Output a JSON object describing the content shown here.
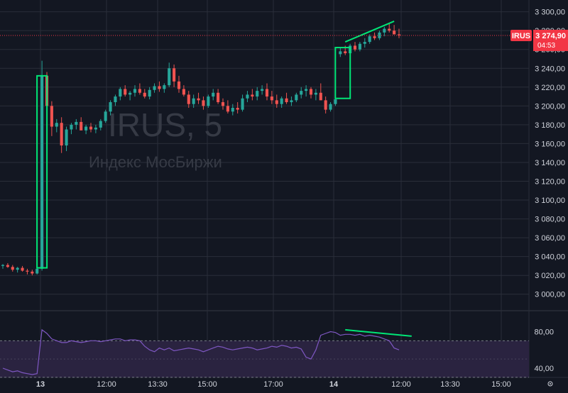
{
  "chart_data": {
    "type": "candlestick",
    "symbol": "IRUS, 5",
    "subtitle": "Индекс МосБиржи",
    "price_axis": {
      "ticks": [
        "3 300,00",
        "3 280,00",
        "3 260,00",
        "3 240,00",
        "3 220,00",
        "3 200,00",
        "3 180,00",
        "3 160,00",
        "3 140,00",
        "3 120,00",
        "3 100,00",
        "3 080,00",
        "3 060,00",
        "3 040,00",
        "3 020,00",
        "3 000,00"
      ],
      "ylim": [
        2990,
        3305
      ]
    },
    "time_axis": {
      "ticks": [
        {
          "label": "13",
          "bold": true
        },
        {
          "label": "12:00",
          "bold": false
        },
        {
          "label": "13:30",
          "bold": false
        },
        {
          "label": "15:00",
          "bold": false
        },
        {
          "label": "17:00",
          "bold": false
        },
        {
          "label": "14",
          "bold": true
        },
        {
          "label": "12:00",
          "bold": false
        },
        {
          "label": "13:30",
          "bold": false
        },
        {
          "label": "15:00",
          "bold": false
        }
      ]
    },
    "last_price": {
      "symbol_label": "IRUS",
      "price": "3 274,90",
      "countdown": "04:53",
      "value": 3274.9
    },
    "rsi": {
      "ticks": [
        "80,00",
        "40,00"
      ],
      "ylim": [
        33,
        92
      ],
      "band": [
        30,
        70
      ]
    },
    "candles": [
      [
        3030,
        3032,
        3027,
        3031
      ],
      [
        3031,
        3033,
        3028,
        3029
      ],
      [
        3029,
        3031,
        3024,
        3026
      ],
      [
        3026,
        3029,
        3023,
        3028
      ],
      [
        3028,
        3030,
        3024,
        3025
      ],
      [
        3025,
        3027,
        3021,
        3024
      ],
      [
        3024,
        3026,
        3020,
        3022
      ],
      [
        3022,
        3028,
        3021,
        3027
      ],
      [
        3027,
        3248,
        3025,
        3232
      ],
      [
        3232,
        3236,
        3195,
        3200
      ],
      [
        3200,
        3205,
        3168,
        3178
      ],
      [
        3178,
        3186,
        3172,
        3182
      ],
      [
        3182,
        3188,
        3150,
        3158
      ],
      [
        3158,
        3178,
        3152,
        3175
      ],
      [
        3175,
        3182,
        3170,
        3180
      ],
      [
        3180,
        3186,
        3175,
        3183
      ],
      [
        3183,
        3188,
        3178,
        3174
      ],
      [
        3174,
        3180,
        3170,
        3178
      ],
      [
        3178,
        3182,
        3172,
        3175
      ],
      [
        3175,
        3180,
        3171,
        3177
      ],
      [
        3177,
        3186,
        3174,
        3184
      ],
      [
        3184,
        3196,
        3182,
        3194
      ],
      [
        3194,
        3206,
        3190,
        3204
      ],
      [
        3204,
        3212,
        3200,
        3210
      ],
      [
        3210,
        3220,
        3206,
        3218
      ],
      [
        3218,
        3222,
        3210,
        3212
      ],
      [
        3212,
        3216,
        3206,
        3214
      ],
      [
        3214,
        3222,
        3210,
        3218
      ],
      [
        3218,
        3224,
        3212,
        3214
      ],
      [
        3214,
        3218,
        3208,
        3210
      ],
      [
        3210,
        3220,
        3207,
        3217
      ],
      [
        3217,
        3224,
        3214,
        3221
      ],
      [
        3221,
        3226,
        3215,
        3218
      ],
      [
        3218,
        3224,
        3214,
        3222
      ],
      [
        3222,
        3246,
        3220,
        3240
      ],
      [
        3240,
        3244,
        3220,
        3226
      ],
      [
        3226,
        3232,
        3214,
        3218
      ],
      [
        3218,
        3222,
        3210,
        3212
      ],
      [
        3212,
        3216,
        3198,
        3202
      ],
      [
        3202,
        3212,
        3198,
        3208
      ],
      [
        3208,
        3214,
        3202,
        3206
      ],
      [
        3206,
        3210,
        3196,
        3200
      ],
      [
        3200,
        3212,
        3198,
        3210
      ],
      [
        3210,
        3218,
        3206,
        3214
      ],
      [
        3214,
        3218,
        3202,
        3204
      ],
      [
        3204,
        3208,
        3196,
        3200
      ],
      [
        3200,
        3206,
        3192,
        3194
      ],
      [
        3194,
        3202,
        3190,
        3198
      ],
      [
        3198,
        3204,
        3192,
        3196
      ],
      [
        3196,
        3212,
        3194,
        3208
      ],
      [
        3208,
        3216,
        3204,
        3212
      ],
      [
        3212,
        3218,
        3206,
        3210
      ],
      [
        3210,
        3220,
        3206,
        3216
      ],
      [
        3216,
        3222,
        3212,
        3218
      ],
      [
        3218,
        3224,
        3206,
        3210
      ],
      [
        3210,
        3216,
        3202,
        3206
      ],
      [
        3206,
        3212,
        3198,
        3202
      ],
      [
        3202,
        3210,
        3198,
        3208
      ],
      [
        3208,
        3214,
        3202,
        3204
      ],
      [
        3204,
        3210,
        3200,
        3206
      ],
      [
        3206,
        3214,
        3204,
        3212
      ],
      [
        3212,
        3220,
        3208,
        3216
      ],
      [
        3216,
        3222,
        3210,
        3218
      ],
      [
        3218,
        3220,
        3208,
        3212
      ],
      [
        3212,
        3218,
        3206,
        3214
      ],
      [
        3214,
        3224,
        3210,
        3206
      ],
      [
        3206,
        3210,
        3192,
        3196
      ],
      [
        3196,
        3204,
        3194,
        3202
      ],
      [
        3202,
        3212,
        3200,
        3207
      ],
      [
        3255,
        3262,
        3252,
        3258
      ],
      [
        3258,
        3264,
        3254,
        3256
      ],
      [
        3256,
        3266,
        3254,
        3264
      ],
      [
        3264,
        3268,
        3258,
        3260
      ],
      [
        3260,
        3268,
        3258,
        3266
      ],
      [
        3266,
        3272,
        3262,
        3268
      ],
      [
        3268,
        3276,
        3266,
        3274
      ],
      [
        3274,
        3278,
        3270,
        3272
      ],
      [
        3272,
        3280,
        3270,
        3278
      ],
      [
        3278,
        3284,
        3274,
        3282
      ],
      [
        3282,
        3288,
        3278,
        3280
      ],
      [
        3280,
        3286,
        3276,
        3276
      ],
      [
        3276,
        3282,
        3272,
        3275
      ]
    ],
    "rsi_values": [
      40,
      38,
      36,
      37,
      35,
      34,
      33,
      34,
      82,
      78,
      72,
      70,
      68,
      68,
      70,
      69,
      68,
      69,
      70,
      70,
      69,
      70,
      71,
      72,
      72,
      70,
      71,
      71,
      70,
      64,
      60,
      58,
      62,
      60,
      62,
      59,
      60,
      61,
      62,
      61,
      60,
      58,
      60,
      62,
      64,
      63,
      61,
      60,
      61,
      62,
      63,
      62,
      60,
      61,
      62,
      64,
      63,
      65,
      64,
      62,
      63,
      61,
      52,
      50,
      60,
      76,
      78,
      80,
      79,
      76,
      77,
      77,
      76,
      77,
      75,
      76,
      75,
      74,
      72,
      70,
      62,
      60
    ],
    "annotations": {
      "rect1": {
        "candles": [
          8,
          8
        ],
        "price": [
          3028,
          3232
        ]
      },
      "rect2": {
        "candles": [
          69,
          70
        ],
        "price": [
          3208,
          3262
        ]
      },
      "trend_price": {
        "from": [
          70,
          3268
        ],
        "to": [
          80,
          3290
        ]
      },
      "trend_rsi": {
        "from": [
          70,
          82
        ],
        "to": [
          83,
          75
        ]
      }
    },
    "colors": {
      "up": "#26a69a",
      "down": "#ef5350",
      "rsi_line": "#7e57c2",
      "rsi_band": "#2a2340",
      "highlight": "#00e676",
      "grid": "#2a2e39",
      "text": "#d1d4dc",
      "price_line": "#f23645"
    }
  }
}
